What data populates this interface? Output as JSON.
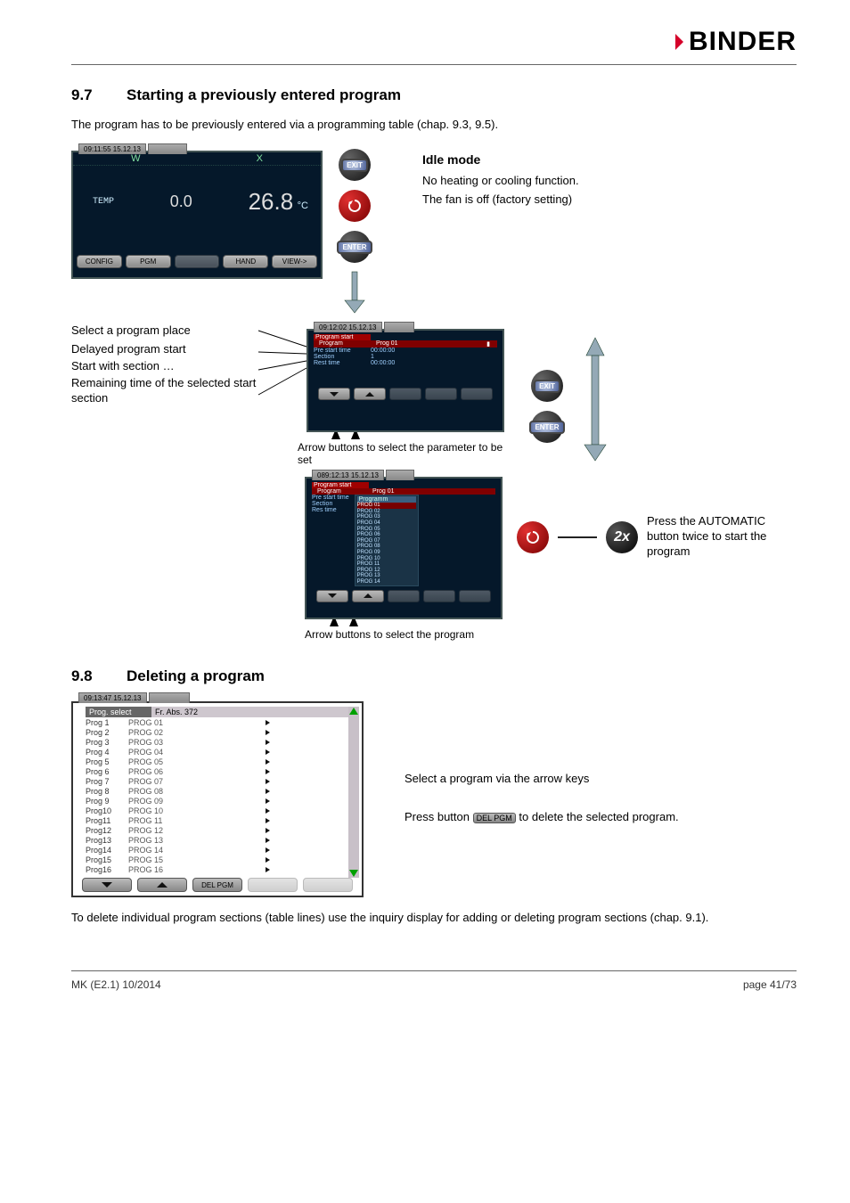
{
  "logo": "BINDER",
  "sec97": {
    "num": "9.7",
    "title": "Starting a previously entered program",
    "intro": "The program has to be previously entered via a programming table (chap. 9.3, 9.5)."
  },
  "idle": {
    "title": "Idle mode",
    "line1": "No heating or cooling function.",
    "line2": "The fan is off (factory setting)"
  },
  "screen1": {
    "timestamp": "09:11:55  15.12.13",
    "W": "W",
    "X": "X",
    "temp_label": "TEMP",
    "val1": "0.0",
    "val2": "26.8",
    "unit": "°C",
    "btn_config": "CONFIG",
    "btn_pgm": "PGM",
    "btn_hand": "HAND",
    "btn_view": "VIEW->"
  },
  "exit": "EXIT",
  "enter": "ENTER",
  "callouts": {
    "c1": "Select a program place",
    "c2": "Delayed program start",
    "c3": "Start with section …",
    "c4": "Remaining time of the selected start section"
  },
  "screen2": {
    "timestamp": "09:12:02  15.12.13",
    "title": "Program start",
    "rows": {
      "program_k": "Program",
      "program_v": "Prog 01",
      "pre_k": "Pre start time",
      "pre_v": "00:00:00",
      "sec_k": "Section",
      "sec_v": "1",
      "rest_k": "Rest time",
      "rest_v": "00:00:00"
    },
    "caption": "Arrow buttons to select the parameter to be set"
  },
  "screen3": {
    "timestamp": "089:12:13  15.12.13",
    "title": "Program start",
    "program_k": "Program",
    "program_v": "Prog 01",
    "pre_k": "Pre start time",
    "sec_k": "Section",
    "rest_k": "Res time",
    "pop_hdr": "Programm",
    "items": [
      "PROG  01",
      "PROG  02",
      "PROG  03",
      "PROG  04",
      "PROG  05",
      "PROG  06",
      "PROG  07",
      "PROG  08",
      "PROG  09",
      "PROG  10",
      "PROG  11",
      "PROG  12",
      "PROG  13",
      "PROG  14"
    ],
    "caption": "Arrow buttons to select the program"
  },
  "two_x": "2x",
  "start_note": "Press the AUTOMATIC button twice to start the program",
  "sec98": {
    "num": "9.8",
    "title": "Deleting a program"
  },
  "proglist": {
    "timestamp": "09:13:47  15.12.13",
    "hdr1": "Prog. select",
    "hdr2": "Fr. Abs. 372",
    "rows": [
      {
        "a": "Prog 1",
        "b": "PROG 01"
      },
      {
        "a": "Prog 2",
        "b": "PROG 02"
      },
      {
        "a": "Prog 3",
        "b": "PROG 03"
      },
      {
        "a": "Prog 4",
        "b": "PROG 04"
      },
      {
        "a": "Prog 5",
        "b": "PROG 05"
      },
      {
        "a": "Prog 6",
        "b": "PROG 06"
      },
      {
        "a": "Prog 7",
        "b": "PROG 07"
      },
      {
        "a": "Prog 8",
        "b": "PROG 08"
      },
      {
        "a": "Prog 9",
        "b": "PROG 09"
      },
      {
        "a": "Prog10",
        "b": "PROG 10"
      },
      {
        "a": "Prog11",
        "b": "PROG 11"
      },
      {
        "a": "Prog12",
        "b": "PROG 12"
      },
      {
        "a": "Prog13",
        "b": "PROG 13"
      },
      {
        "a": "Prog14",
        "b": "PROG 14"
      },
      {
        "a": "Prog15",
        "b": "PROG 15"
      },
      {
        "a": "Prog16",
        "b": "PROG 16"
      }
    ],
    "btn_del": "DEL PGM"
  },
  "sel_text": "Select a program via the arrow keys",
  "press_a": "Press button ",
  "press_btn": "DEL PGM",
  "press_b": " to delete the selected program.",
  "del_body": "To delete individual program sections (table lines) use the inquiry display for adding or deleting program sections (chap. 9.1).",
  "footer": {
    "left": "MK (E2.1) 10/2014",
    "right": "page 41/73"
  }
}
